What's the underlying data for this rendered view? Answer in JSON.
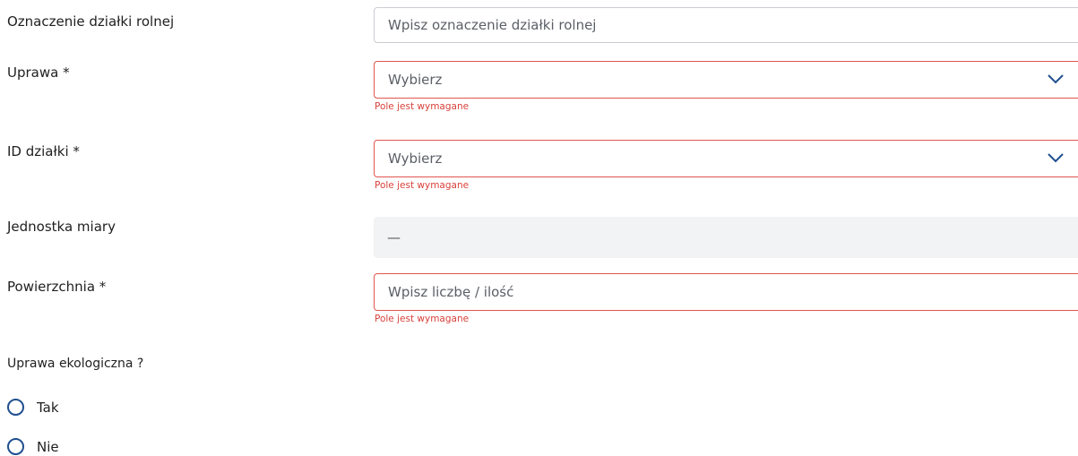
{
  "form": {
    "plot_designation": {
      "label": "Oznaczenie działki rolnej",
      "placeholder": "Wpisz oznaczenie działki rolnej"
    },
    "crop": {
      "label": "Uprawa *",
      "value": "Wybierz",
      "error": "Pole jest wymagane"
    },
    "plot_id": {
      "label": "ID działki *",
      "value": "Wybierz",
      "error": "Pole jest wymagane"
    },
    "unit": {
      "label": "Jednostka miary",
      "value": "—"
    },
    "area": {
      "label": "Powierzchnia  *",
      "placeholder": "Wpisz liczbę / ilość",
      "error": "Pole jest wymagane"
    },
    "organic": {
      "label": "Uprawa ekologiczna ?",
      "options": [
        "Tak",
        "Nie"
      ]
    }
  },
  "colors": {
    "error": "#d9413b",
    "accent": "#1f4f8f",
    "border": "#c9ccd1"
  },
  "icons": {
    "select": "chevron-down-icon",
    "radio": "radio-unchecked-icon"
  }
}
